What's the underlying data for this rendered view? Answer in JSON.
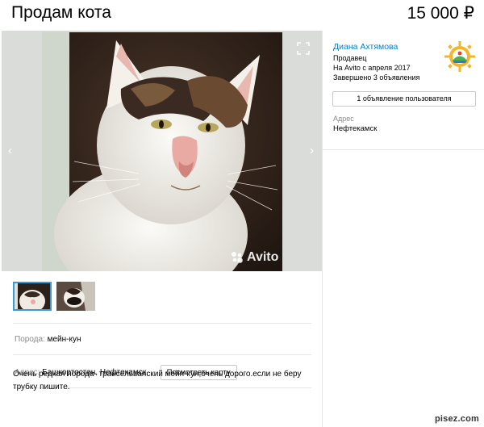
{
  "listing": {
    "title": "Продам кота",
    "price": "15 000 ₽"
  },
  "gallery": {
    "watermark": "Avito",
    "prev_icon": "chevron-left-icon",
    "next_icon": "chevron-right-icon",
    "fullscreen_icon": "expand-icon",
    "thumbnail_count": 2
  },
  "params": {
    "breed_label": "Порода:",
    "breed_value": "мейн-кун",
    "address_label": "Адрес:",
    "address_value": "Башкортостан, Нефтекамск,",
    "map_button": "Посмотреть карту"
  },
  "description": "Очень редкая порода- трансельванский мейн-кун,очень дорого.если не беру трубку пишите.",
  "seller": {
    "name": "Диана Ахтямова",
    "role": "Продавец",
    "since": "На Avito с апреля 2017",
    "completed": "Завершено 3 объявления",
    "listings_button": "1 объявление пользователя",
    "address_label": "Адрес",
    "address_value": "Нефтекамск"
  },
  "footer": {
    "site_mark": "pisez.com"
  },
  "colors": {
    "link": "#0a7ec2",
    "muted": "#8a8a8a",
    "thumb_active": "#3d97d3"
  }
}
